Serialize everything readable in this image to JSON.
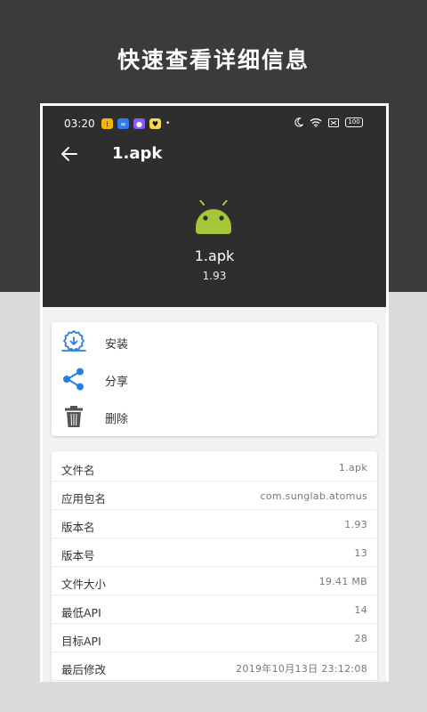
{
  "promo": {
    "title": "快速查看详细信息"
  },
  "status_bar": {
    "time": "03:20",
    "battery": "100",
    "icons": [
      "app-yellow-icon",
      "app-blue-icon",
      "app-purple-icon",
      "app-lightyellow-icon",
      "moon-icon",
      "wifi-icon",
      "sim-icon",
      "battery-icon"
    ]
  },
  "toolbar": {
    "title": "1.apk"
  },
  "apk": {
    "name": "1.apk",
    "version": "1.93",
    "icon_color": "#a4c639"
  },
  "actions": [
    {
      "label": "安装",
      "icon": "install-icon"
    },
    {
      "label": "分享",
      "icon": "share-icon"
    },
    {
      "label": "删除",
      "icon": "trash-icon"
    }
  ],
  "accent_color": "#2b7de1",
  "info": [
    {
      "label": "文件名",
      "value": "1.apk"
    },
    {
      "label": "应用包名",
      "value": "com.sunglab.atomus"
    },
    {
      "label": "版本名",
      "value": "1.93"
    },
    {
      "label": "版本号",
      "value": "13"
    },
    {
      "label": "文件大小",
      "value": "19.41 MB"
    },
    {
      "label": "最低API",
      "value": "14"
    },
    {
      "label": "目标API",
      "value": "28"
    },
    {
      "label": "最后修改",
      "value": "2019年10月13日 23:12:08"
    }
  ]
}
